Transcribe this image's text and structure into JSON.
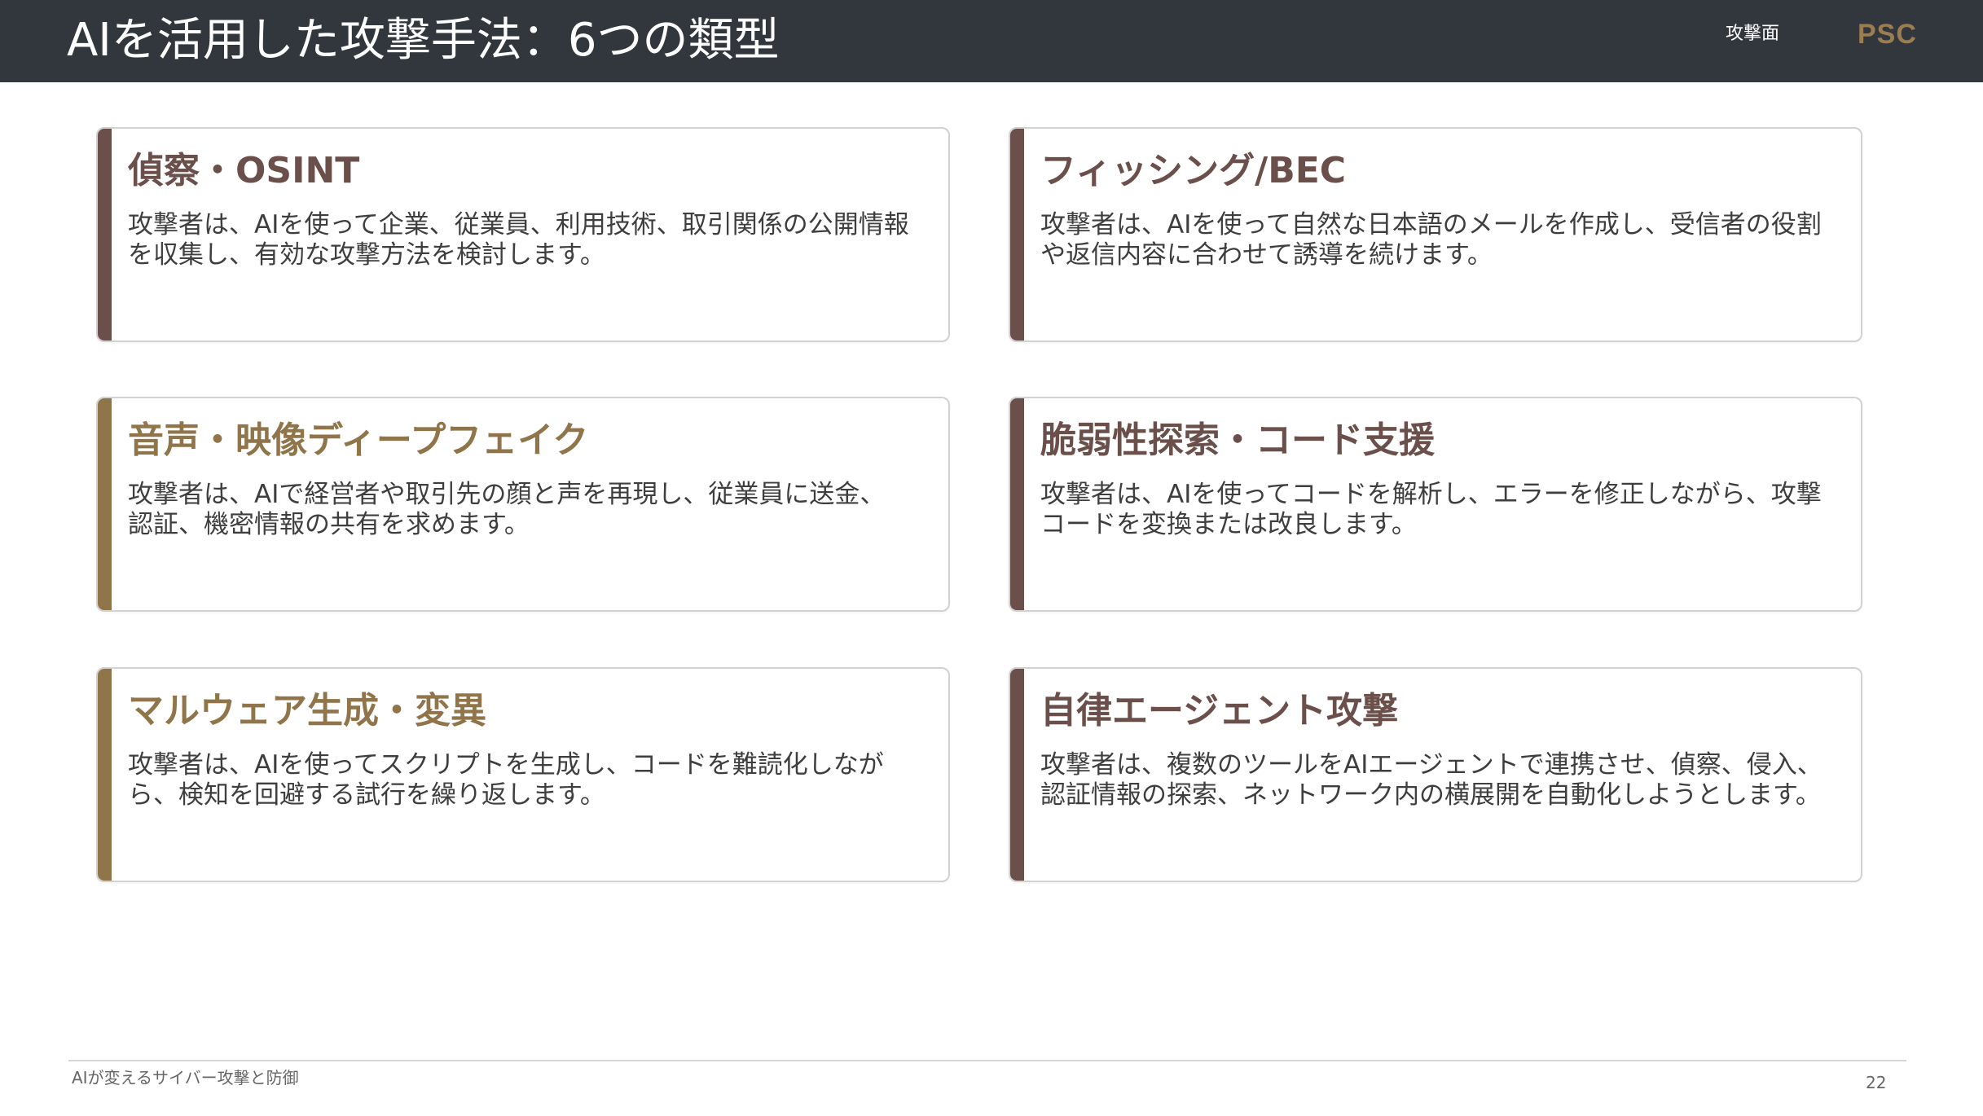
{
  "header": {
    "title": "AIを活用した攻撃手法：6つの類型",
    "section_label": "攻撃面",
    "logo_text": "PSC",
    "background_color": "#32363d",
    "logo_color": "#9b7d52"
  },
  "cards": [
    {
      "title": "偵察・OSINT",
      "body": "攻撃者は、AIを使って企業、従業員、利用技術、取引関係の公開情報を収集し、有効な攻撃方法を検討します。",
      "accent_color": "#6b4f4b"
    },
    {
      "title": "フィッシング/BEC",
      "body": "攻撃者は、AIを使って自然な日本語のメールを作成し、受信者の役割や返信内容に合わせて誘導を続けます。",
      "accent_color": "#6b4f4b"
    },
    {
      "title": "音声・映像ディープフェイク",
      "body": "攻撃者は、AIで経営者や取引先の顔と声を再現し、従業員に送金、認証、機密情報の共有を求めます。",
      "accent_color": "#8f7549"
    },
    {
      "title": "脆弱性探索・コード支援",
      "body": "攻撃者は、AIを使ってコードを解析し、エラーを修正しながら、攻撃コードを変換または改良します。",
      "accent_color": "#6b4f4b"
    },
    {
      "title": "マルウェア生成・変異",
      "body": "攻撃者は、AIを使ってスクリプトを生成し、コードを難読化しながら、検知を回避する試行を繰り返します。",
      "accent_color": "#8f7549"
    },
    {
      "title": "自律エージェント攻撃",
      "body": "攻撃者は、複数のツールをAIエージェントで連携させ、偵察、侵入、認証情報の探索、ネットワーク内の横展開を自動化しようとします。",
      "accent_color": "#6b4f4b"
    }
  ],
  "footer": {
    "text": "AIが変えるサイバー攻撃と防御",
    "page_number": "22"
  }
}
